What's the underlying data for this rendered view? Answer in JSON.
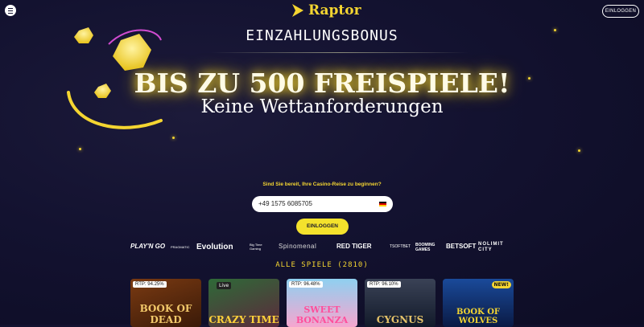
{
  "header": {
    "logo_text": "Raptor",
    "login_label": "EINLOGGEN"
  },
  "hero": {
    "title": "EINZAHLUNGSBONUS",
    "headline": "BIS ZU 500 FREISPIELE!",
    "subheadline": "Keine Wettanforderungen"
  },
  "signup": {
    "prompt": "Sind Sie bereit, Ihre Casino-Reise zu beginnen?",
    "phone_value": "+49 1575 6085705",
    "login_label": "EINLOGGEN"
  },
  "providers": [
    "PLAY'N GO",
    "PRAGMATIC",
    "Evolution",
    "Big Time Gaming",
    "Spinomenal",
    "RED TIGER",
    "TSOFTBET",
    "BOOMING GAMES",
    "BETSOFT",
    "NOLIMIT CITY"
  ],
  "games": {
    "heading": "ALLE SPIELE (2810)",
    "cards": [
      {
        "rtp": "RTP: 94.25%",
        "title": "BOOK OF DEAD"
      },
      {
        "tag": "Live",
        "title": "CRAZY TIME"
      },
      {
        "rtp": "RTP: 96.48%",
        "title": "SWEET BONANZA"
      },
      {
        "rtp": "RTP: 96.10%",
        "title": "CYGNUS"
      },
      {
        "tag": "NEW!",
        "title": "BOOK OF WOLVES"
      }
    ]
  },
  "colors": {
    "accent": "#f4d531",
    "background": "#131230"
  }
}
